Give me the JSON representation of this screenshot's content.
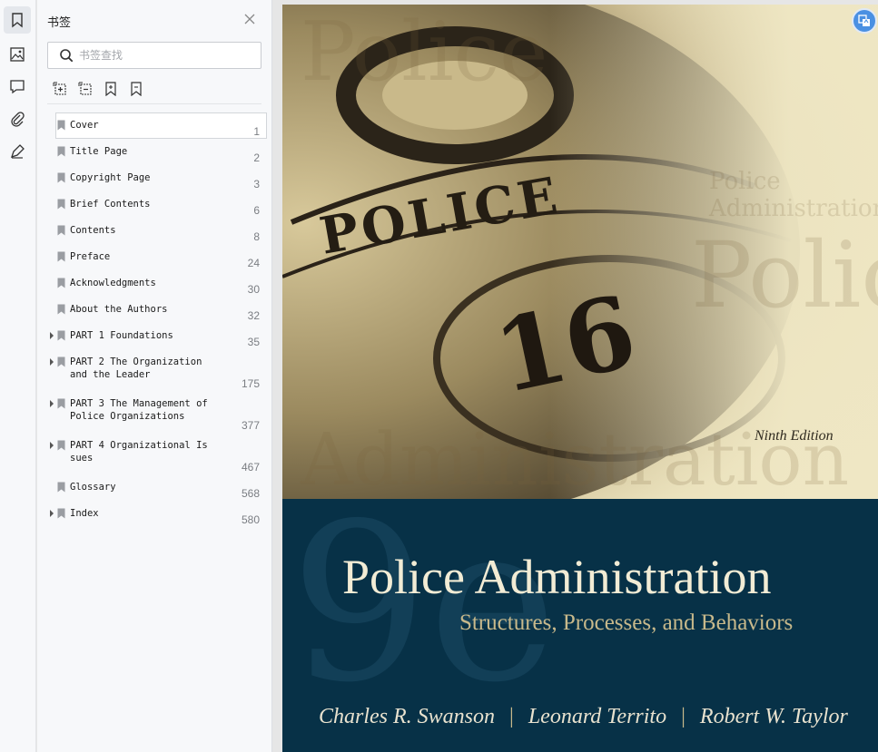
{
  "panel": {
    "title": "书签",
    "search_placeholder": "书签查找"
  },
  "bookmarks": [
    {
      "label": "Cover",
      "page": "1",
      "expandable": false
    },
    {
      "label": "Title Page",
      "page": "2",
      "expandable": false
    },
    {
      "label": "Copyright Page",
      "page": "3",
      "expandable": false
    },
    {
      "label": "Brief Contents",
      "page": "6",
      "expandable": false
    },
    {
      "label": "Contents",
      "page": "8",
      "expandable": false
    },
    {
      "label": "Preface",
      "page": "24",
      "expandable": false
    },
    {
      "label": "Acknowledgments",
      "page": "30",
      "expandable": false
    },
    {
      "label": "About the Authors",
      "page": "32",
      "expandable": false
    },
    {
      "label": "PART 1 Foundations",
      "page": "35",
      "expandable": true
    },
    {
      "label": "PART 2 The Organization\nand the Leader",
      "page": "175",
      "expandable": true
    },
    {
      "label": "PART 3 The Management of\nPolice Organizations",
      "page": "377",
      "expandable": true
    },
    {
      "label": "PART 4 Organizational Is\nsues",
      "page": "467",
      "expandable": true
    },
    {
      "label": "Glossary",
      "page": "568",
      "expandable": false
    },
    {
      "label": "Index",
      "page": "580",
      "expandable": true
    }
  ],
  "cover": {
    "badge_text": "POLICE",
    "badge_number": "16",
    "edition": "Ninth Edition",
    "big_mark": "9e",
    "title": "Police Administration",
    "subtitle": "Structures, Processes, and Behaviors",
    "authors": [
      "Charles R. Swanson",
      "Leonard Territo",
      "Robert W. Taylor"
    ],
    "separator": "|",
    "bg_words": [
      "Police",
      "Administration",
      "Police",
      "Police",
      "Administration"
    ]
  },
  "colors": {
    "accent": "#4a90e2",
    "cover_dark": "#073147"
  }
}
